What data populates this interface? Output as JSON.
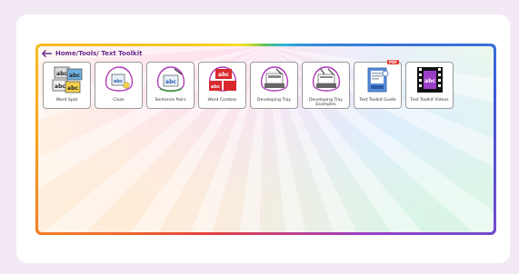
{
  "breadcrumb": {
    "text": "Home/Tools/ Text Toolkit"
  },
  "tiles": [
    {
      "label": "Word Spot",
      "icon": "word-spot-icon"
    },
    {
      "label": "Cloze",
      "icon": "cloze-icon"
    },
    {
      "label": "Sentence Pairs",
      "icon": "sentence-pairs-icon"
    },
    {
      "label": "Word Combos",
      "icon": "word-combos-icon"
    },
    {
      "label": "Developing Tray",
      "icon": "developing-tray-icon"
    },
    {
      "label": "Developing Tray Examples",
      "icon": "developing-tray-examples-icon"
    },
    {
      "label": "Text Toolkit Guide",
      "icon": "guide-pdf-icon",
      "badge": "PDF"
    },
    {
      "label": "Text Toolkit Videos",
      "icon": "film-videos-icon"
    }
  ],
  "icon_text": {
    "abc": "abc"
  },
  "colors": {
    "accent": "#6a2a8a",
    "background": "#f3e9f5"
  }
}
